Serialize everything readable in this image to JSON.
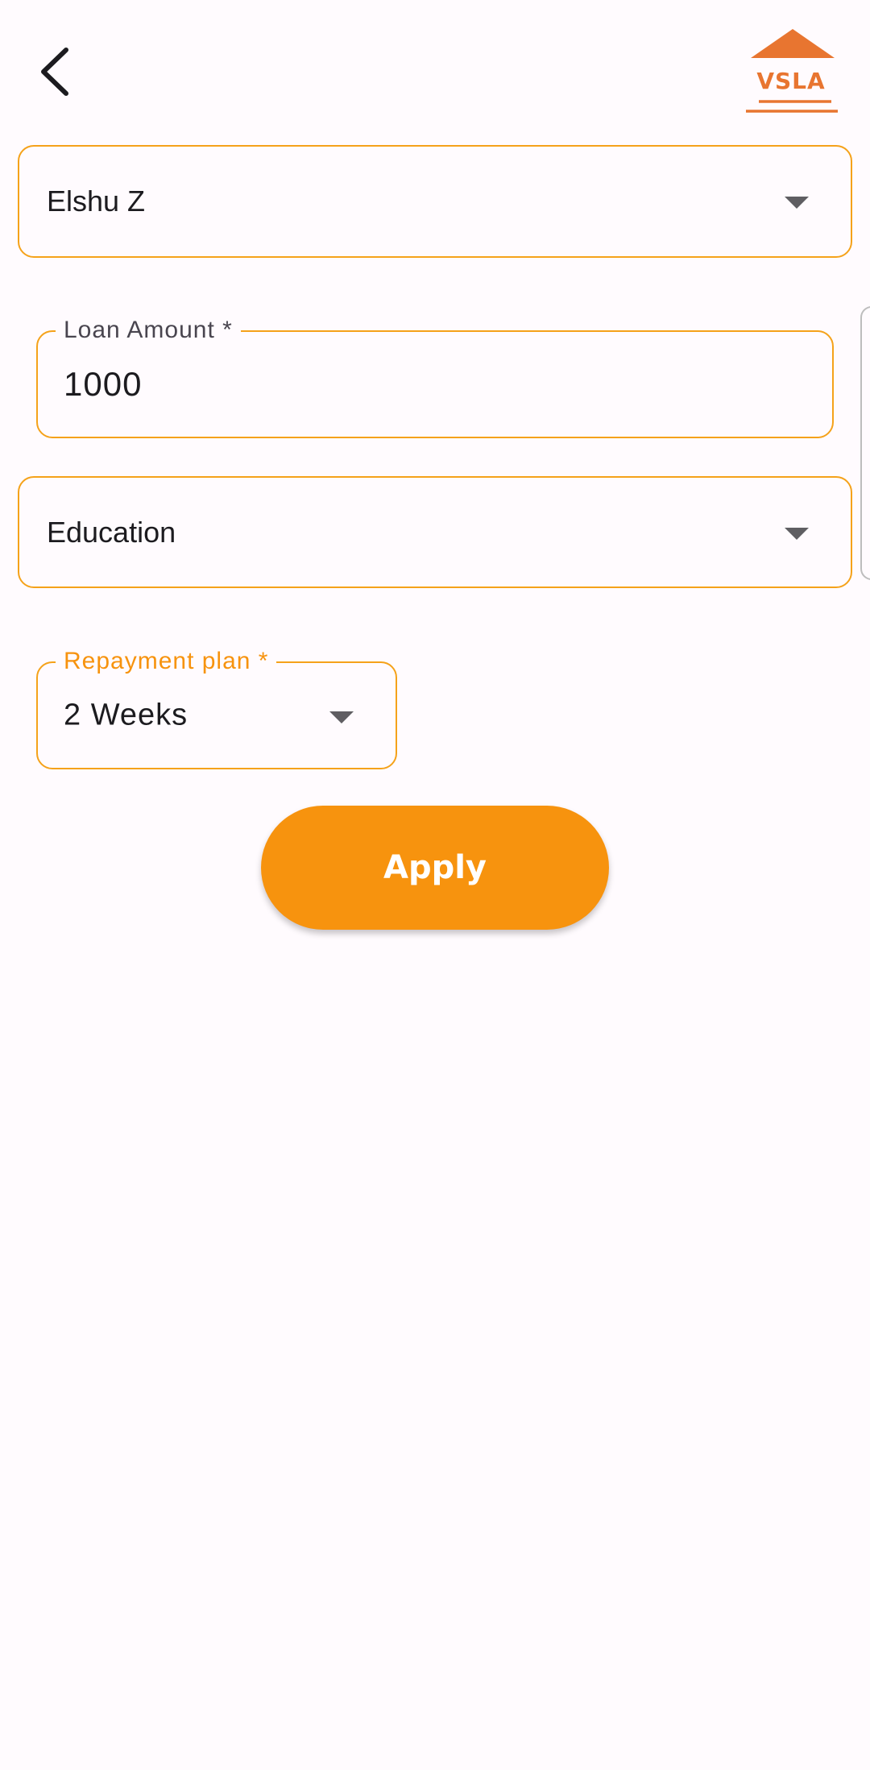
{
  "header": {
    "back_icon": "chevron-left-icon",
    "logo_text": "VSLA"
  },
  "member_select": {
    "value": "Elshu Z",
    "icon": "dropdown-arrow-icon"
  },
  "loan_amount": {
    "label": "Loan Amount *",
    "value": "1000"
  },
  "purpose_select": {
    "value": "Education",
    "icon": "dropdown-arrow-icon"
  },
  "repayment_plan": {
    "label": "Repayment plan *",
    "value": "2 Weeks",
    "icon": "dropdown-arrow-icon"
  },
  "actions": {
    "apply_label": "Apply"
  },
  "colors": {
    "accent": "#F7930E",
    "field_border": "#F5A21A",
    "logo": "#E87530",
    "background": "#FFFBFE"
  }
}
